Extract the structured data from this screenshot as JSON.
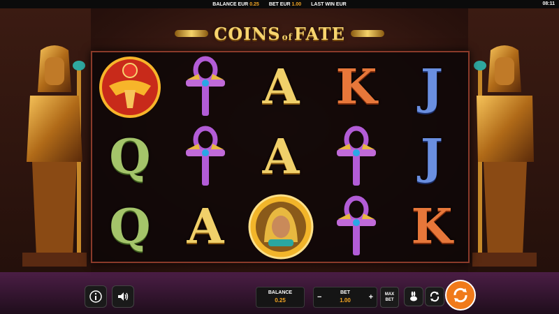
{
  "topbar": {
    "balance_label": "BALANCE EUR",
    "balance_value": "0.25",
    "bet_label": "BET EUR",
    "bet_value": "1.00",
    "lastwin_label": "LAST WIN EUR",
    "lastwin_value": "",
    "clock": "08:11"
  },
  "game": {
    "title_main_left": "COINS",
    "title_of": "of",
    "title_main_right": "FATE"
  },
  "reels": [
    [
      "scarab-wild",
      "ankh",
      "A",
      "K",
      "J"
    ],
    [
      "Q",
      "ankh",
      "A",
      "ankh",
      "J"
    ],
    [
      "Q",
      "A",
      "cleopatra-coin",
      "ankh",
      "K"
    ]
  ],
  "controls": {
    "balance_label": "BALANCE",
    "balance_value": "0.25",
    "bet_label": "BET",
    "bet_value": "1.00",
    "minus": "−",
    "plus": "+",
    "maxbet_line1": "MAX",
    "maxbet_line2": "BET"
  },
  "icons": {
    "info": "info-icon",
    "sound": "speaker-icon",
    "turbo": "rabbit-icon",
    "autoplay": "autoplay-icon",
    "spin": "spin-icon"
  },
  "colors": {
    "accent": "#f5a623",
    "spin": "#f07a1a"
  }
}
